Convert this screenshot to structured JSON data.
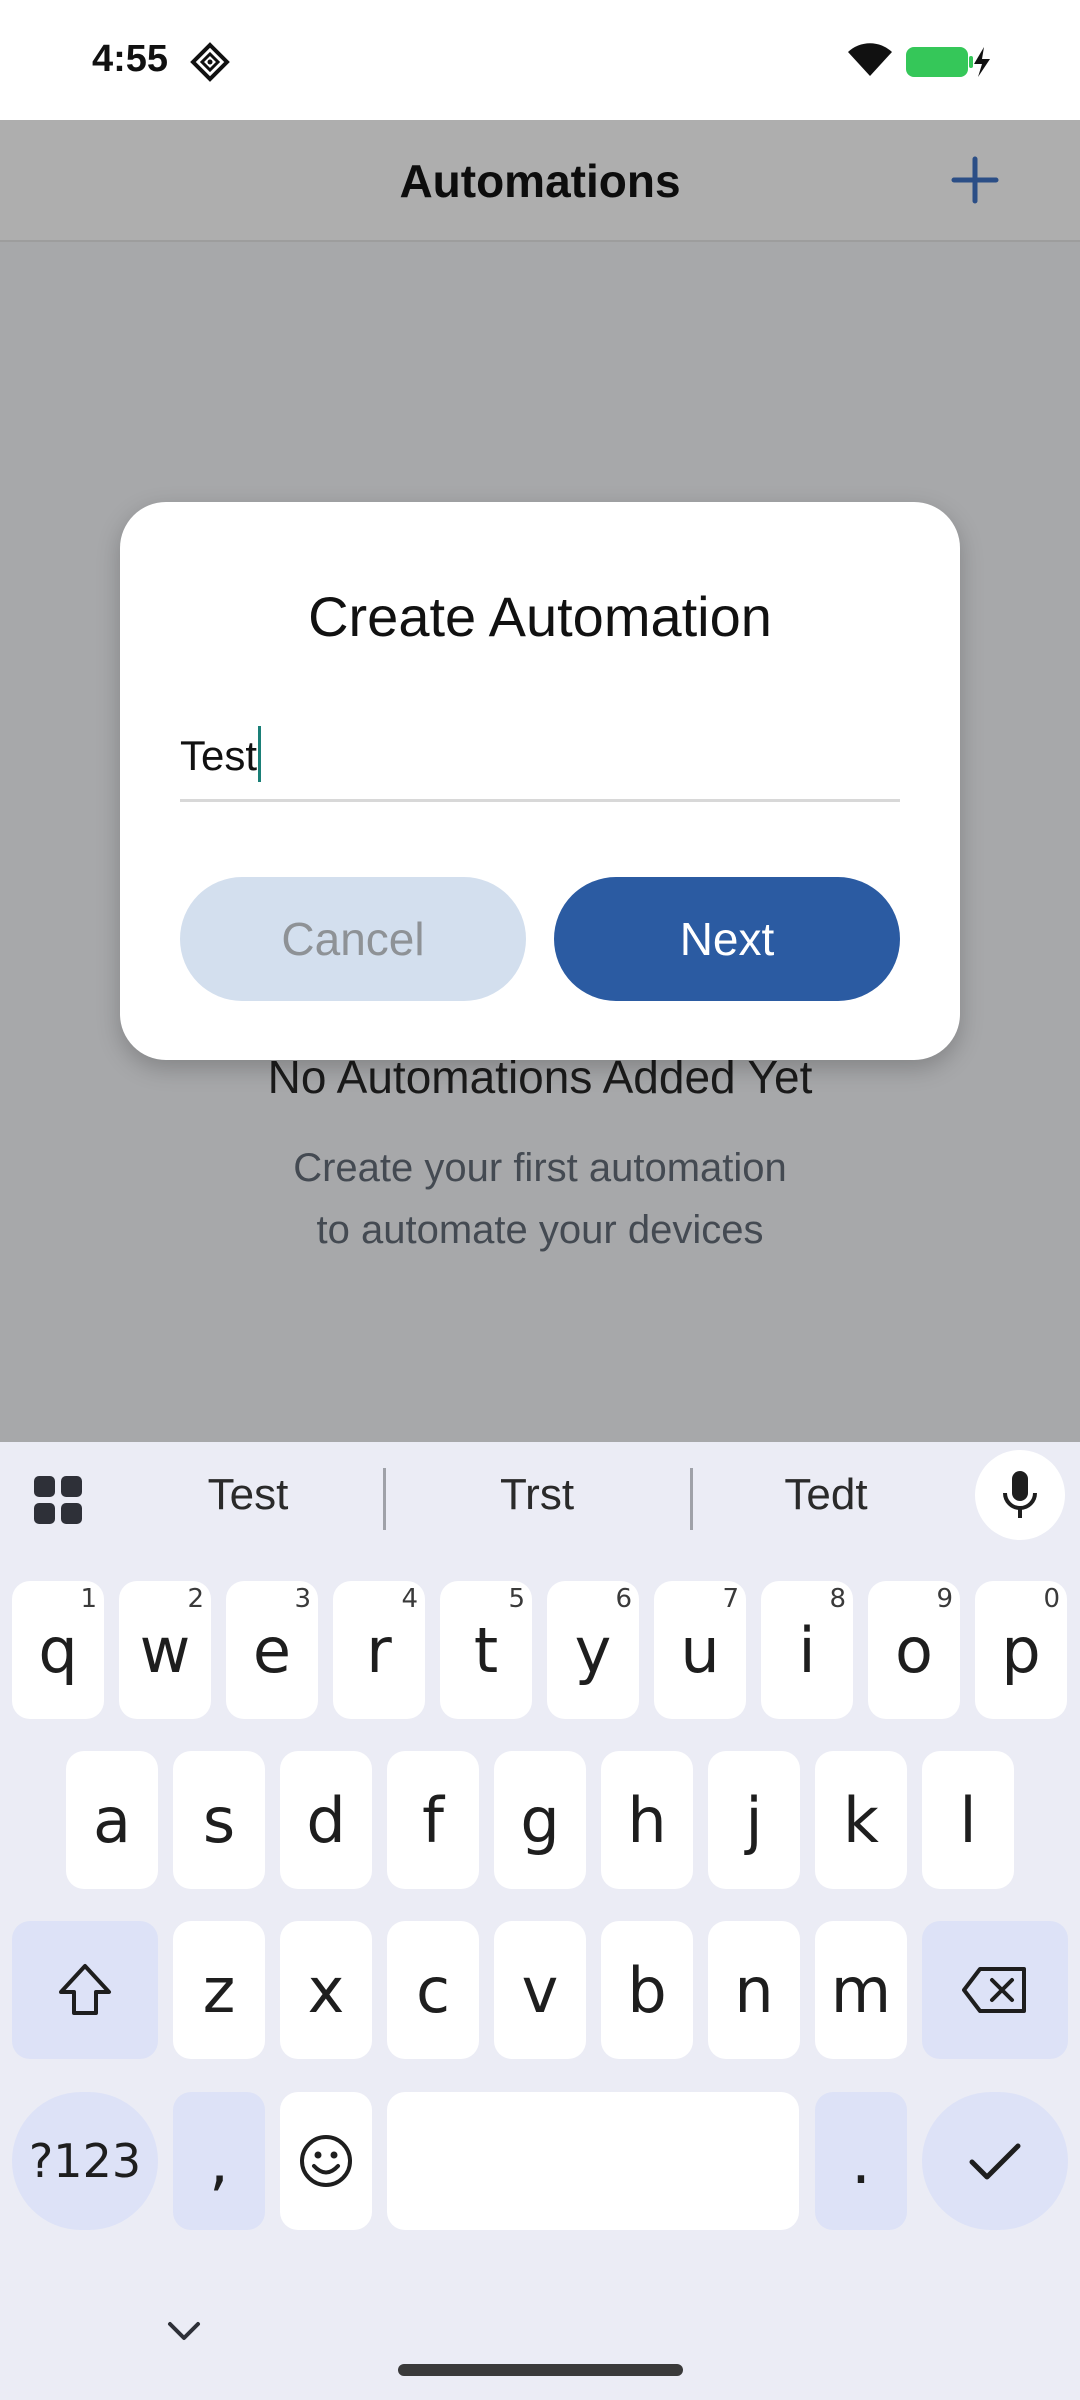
{
  "status_bar": {
    "time": "4:55"
  },
  "app_bar": {
    "title": "Automations"
  },
  "empty_state": {
    "title": "No Automations Added Yet",
    "subtitle_line1": "Create your first automation",
    "subtitle_line2": "to automate your devices"
  },
  "dialog": {
    "title": "Create Automation",
    "input_value": "Test",
    "cancel_label": "Cancel",
    "next_label": "Next"
  },
  "keyboard": {
    "suggestions": [
      "Test",
      "Trst",
      "Tedt"
    ],
    "row1": [
      {
        "k": "q",
        "n": "1"
      },
      {
        "k": "w",
        "n": "2"
      },
      {
        "k": "e",
        "n": "3"
      },
      {
        "k": "r",
        "n": "4"
      },
      {
        "k": "t",
        "n": "5"
      },
      {
        "k": "y",
        "n": "6"
      },
      {
        "k": "u",
        "n": "7"
      },
      {
        "k": "i",
        "n": "8"
      },
      {
        "k": "o",
        "n": "9"
      },
      {
        "k": "p",
        "n": "0"
      }
    ],
    "row2": [
      "a",
      "s",
      "d",
      "f",
      "g",
      "h",
      "j",
      "k",
      "l"
    ],
    "row3": [
      "z",
      "x",
      "c",
      "v",
      "b",
      "n",
      "m"
    ],
    "symbols_label": "?123",
    "comma_label": ",",
    "period_label": "."
  },
  "colors": {
    "accent": "#2b5ba2",
    "cancel_bg": "#d3dfee",
    "caret": "#1a7f77",
    "scrim": "#a7a8aa",
    "keyboard_bg": "#ebecf5",
    "battery": "#35c759"
  }
}
